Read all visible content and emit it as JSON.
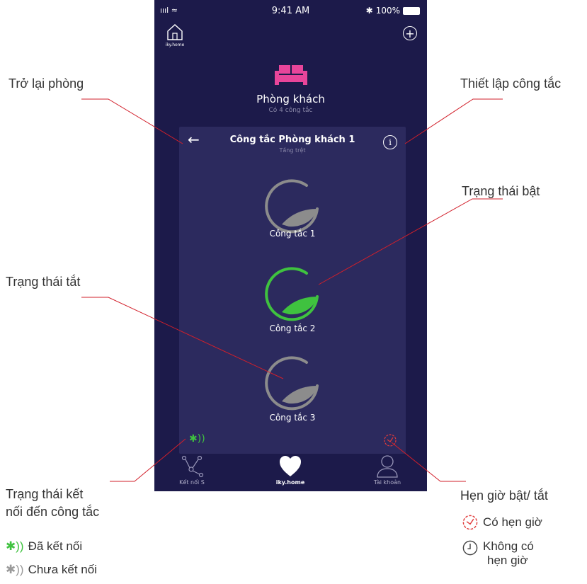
{
  "status": {
    "time": "9:41 AM",
    "battery": "100%",
    "signal": "ıııl ≈"
  },
  "header": {
    "logo_label": "iky.home",
    "add_label": "+"
  },
  "room": {
    "name": "Phòng khách",
    "subtitle": "Có 4 công tắc"
  },
  "panel": {
    "title": "Công tắc Phòng khách 1",
    "subtitle": "Tầng trệt",
    "back": "←",
    "info": "i"
  },
  "switches": [
    {
      "label": "Công tắc 1",
      "state": "off",
      "color": "#8c8c8c"
    },
    {
      "label": "Công tắc 2",
      "state": "on",
      "color": "#3fc23f"
    },
    {
      "label": "Công tắc 3",
      "state": "off",
      "color": "#8c8c8c"
    }
  ],
  "bluetooth": {
    "glyph": "✱))",
    "color": "#3fc23f"
  },
  "tabs": [
    {
      "label": "Kết nối S"
    },
    {
      "label": "iky.home"
    },
    {
      "label": "Tài khoản"
    }
  ],
  "annotations": {
    "back_room": "Trở lại phòng",
    "switch_setup": "Thiết lập công tắc",
    "state_on": "Trạng thái bật",
    "state_off": "Trạng thái tắt",
    "conn_state_line1": "Trạng thái kết",
    "conn_state_line2": "nối đến công tắc",
    "connected": "Đã kết nối",
    "not_connected": "Chưa kết nối",
    "timer": "Hẹn giờ bật/ tắt",
    "has_timer": "Có hẹn giờ",
    "no_timer_line1": "Không có",
    "no_timer_line2": "hẹn giờ"
  },
  "colors": {
    "bg": "#1c1a4a",
    "panel": "#2c2a5e",
    "accent_pink": "#e8459a",
    "line_red": "#d21f2a",
    "timer_red": "#e03a3a"
  }
}
